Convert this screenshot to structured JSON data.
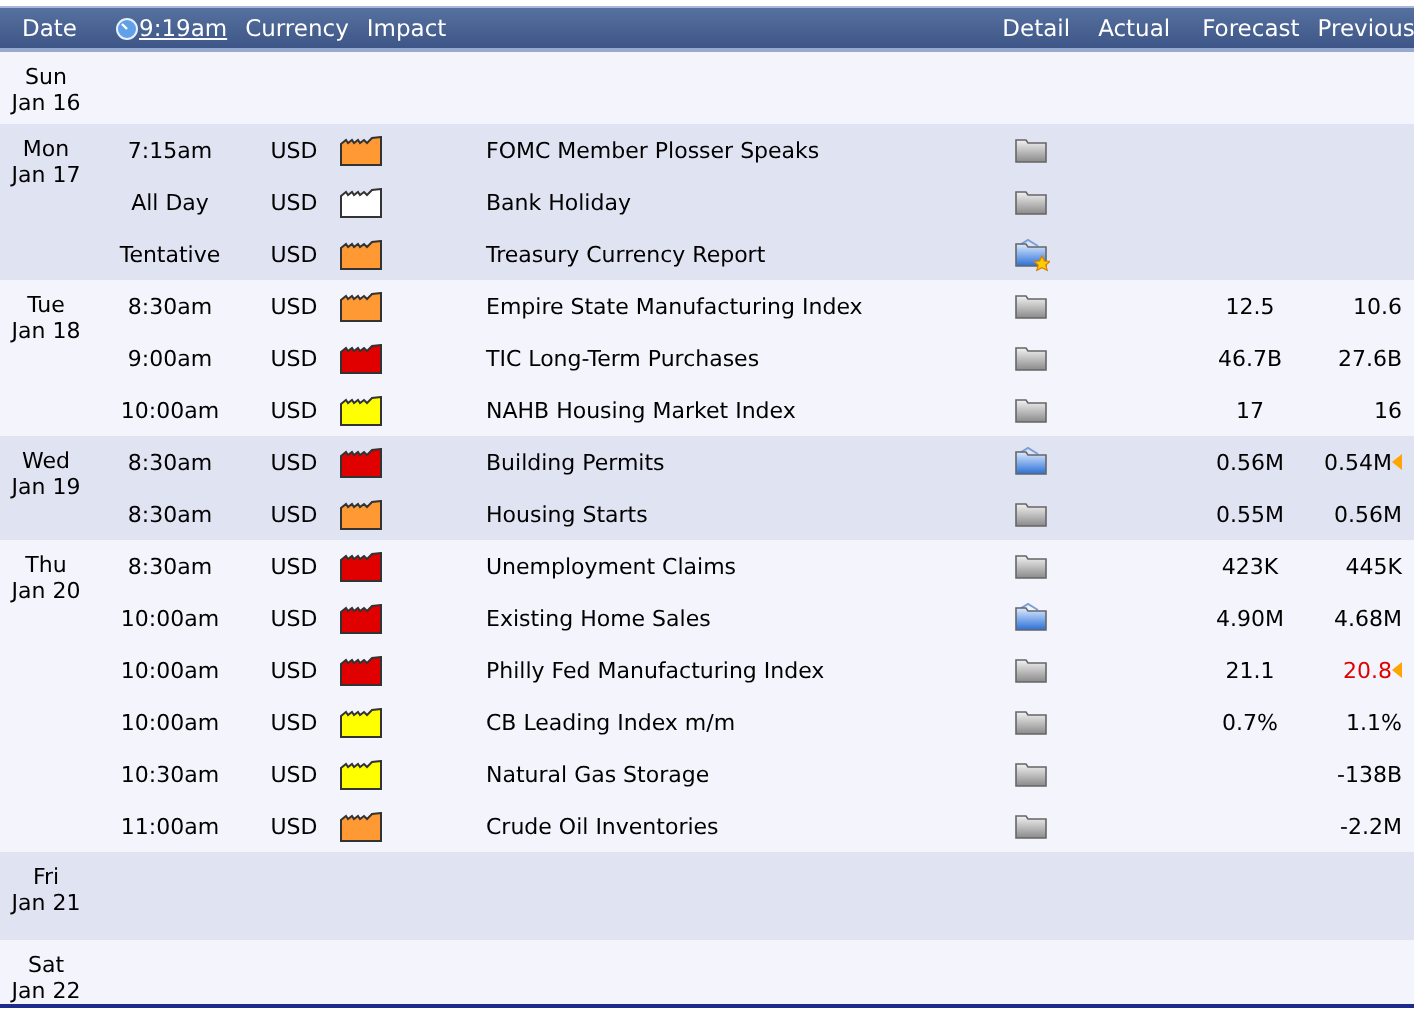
{
  "header": {
    "date": "Date",
    "time": "9:19am",
    "currency": "Currency",
    "impact": "Impact",
    "detail": "Detail",
    "actual": "Actual",
    "forecast": "Forecast",
    "previous": "Previous"
  },
  "days": [
    {
      "day": "Sun",
      "date": "Jan 16"
    },
    {
      "day": "Mon",
      "date": "Jan 17",
      "events": [
        {
          "time": "7:15am",
          "currency": "USD",
          "color": "#ff9933",
          "title": "FOMC Member Plosser Speaks",
          "detail_new": false,
          "detail_starred": false,
          "previous_revised": false
        },
        {
          "time": "All Day",
          "currency": "USD",
          "color": "#ffffff",
          "title": "Bank Holiday",
          "detail_new": false,
          "detail_starred": false,
          "previous_revised": false
        },
        {
          "time": "Tentative",
          "currency": "USD",
          "color": "#ff9933",
          "title": "Treasury Currency Report",
          "detail_new": true,
          "detail_starred": true,
          "previous_revised": false
        }
      ]
    },
    {
      "day": "Tue",
      "date": "Jan 18",
      "events": [
        {
          "time": "8:30am",
          "currency": "USD",
          "color": "#ff9933",
          "title": "Empire State Manufacturing Index",
          "detail_new": false,
          "detail_starred": false,
          "forecast": "12.5",
          "previous": "10.6",
          "previous_revised": false
        },
        {
          "time": "9:00am",
          "currency": "USD",
          "color": "#e00000",
          "title": "TIC Long-Term Purchases",
          "detail_new": false,
          "detail_starred": false,
          "forecast": "46.7B",
          "previous": "27.6B",
          "previous_revised": false
        },
        {
          "time": "10:00am",
          "currency": "USD",
          "color": "#ffff00",
          "title": "NAHB Housing Market Index",
          "detail_new": false,
          "detail_starred": false,
          "forecast": "17",
          "previous": "16",
          "previous_revised": false
        }
      ]
    },
    {
      "day": "Wed",
      "date": "Jan 19",
      "events": [
        {
          "time": "8:30am",
          "currency": "USD",
          "color": "#e00000",
          "title": "Building Permits",
          "detail_new": true,
          "detail_starred": false,
          "forecast": "0.56M",
          "previous": "0.54M",
          "previous_revised": true,
          "previous_worse": false
        },
        {
          "time": "8:30am",
          "currency": "USD",
          "color": "#ff9933",
          "title": "Housing Starts",
          "detail_new": false,
          "detail_starred": false,
          "forecast": "0.55M",
          "previous": "0.56M",
          "previous_revised": false
        }
      ]
    },
    {
      "day": "Thu",
      "date": "Jan 20",
      "events": [
        {
          "time": "8:30am",
          "currency": "USD",
          "color": "#e00000",
          "title": "Unemployment Claims",
          "detail_new": false,
          "detail_starred": false,
          "forecast": "423K",
          "previous": "445K",
          "previous_revised": false
        },
        {
          "time": "10:00am",
          "currency": "USD",
          "color": "#e00000",
          "title": "Existing Home Sales",
          "detail_new": true,
          "detail_starred": false,
          "forecast": "4.90M",
          "previous": "4.68M",
          "previous_revised": false
        },
        {
          "time": "10:00am",
          "currency": "USD",
          "color": "#e00000",
          "title": "Philly Fed Manufacturing Index",
          "detail_new": false,
          "detail_starred": false,
          "forecast": "21.1",
          "previous": "20.8",
          "previous_revised": true,
          "previous_worse": true
        },
        {
          "time": "10:00am",
          "currency": "USD",
          "color": "#ffff00",
          "title": "CB Leading Index m/m",
          "detail_new": false,
          "detail_starred": false,
          "forecast": "0.7%",
          "previous": "1.1%",
          "previous_revised": false
        },
        {
          "time": "10:30am",
          "currency": "USD",
          "color": "#ffff00",
          "title": "Natural Gas Storage",
          "detail_new": false,
          "detail_starred": false,
          "previous": "-138B",
          "previous_revised": false
        },
        {
          "time": "11:00am",
          "currency": "USD",
          "color": "#ff9933",
          "title": "Crude Oil Inventories",
          "detail_new": false,
          "detail_starred": false,
          "previous": "-2.2M",
          "previous_revised": false
        }
      ]
    },
    {
      "day": "Fri",
      "date": "Jan 21"
    },
    {
      "day": "Sat",
      "date": "Jan 22"
    }
  ]
}
